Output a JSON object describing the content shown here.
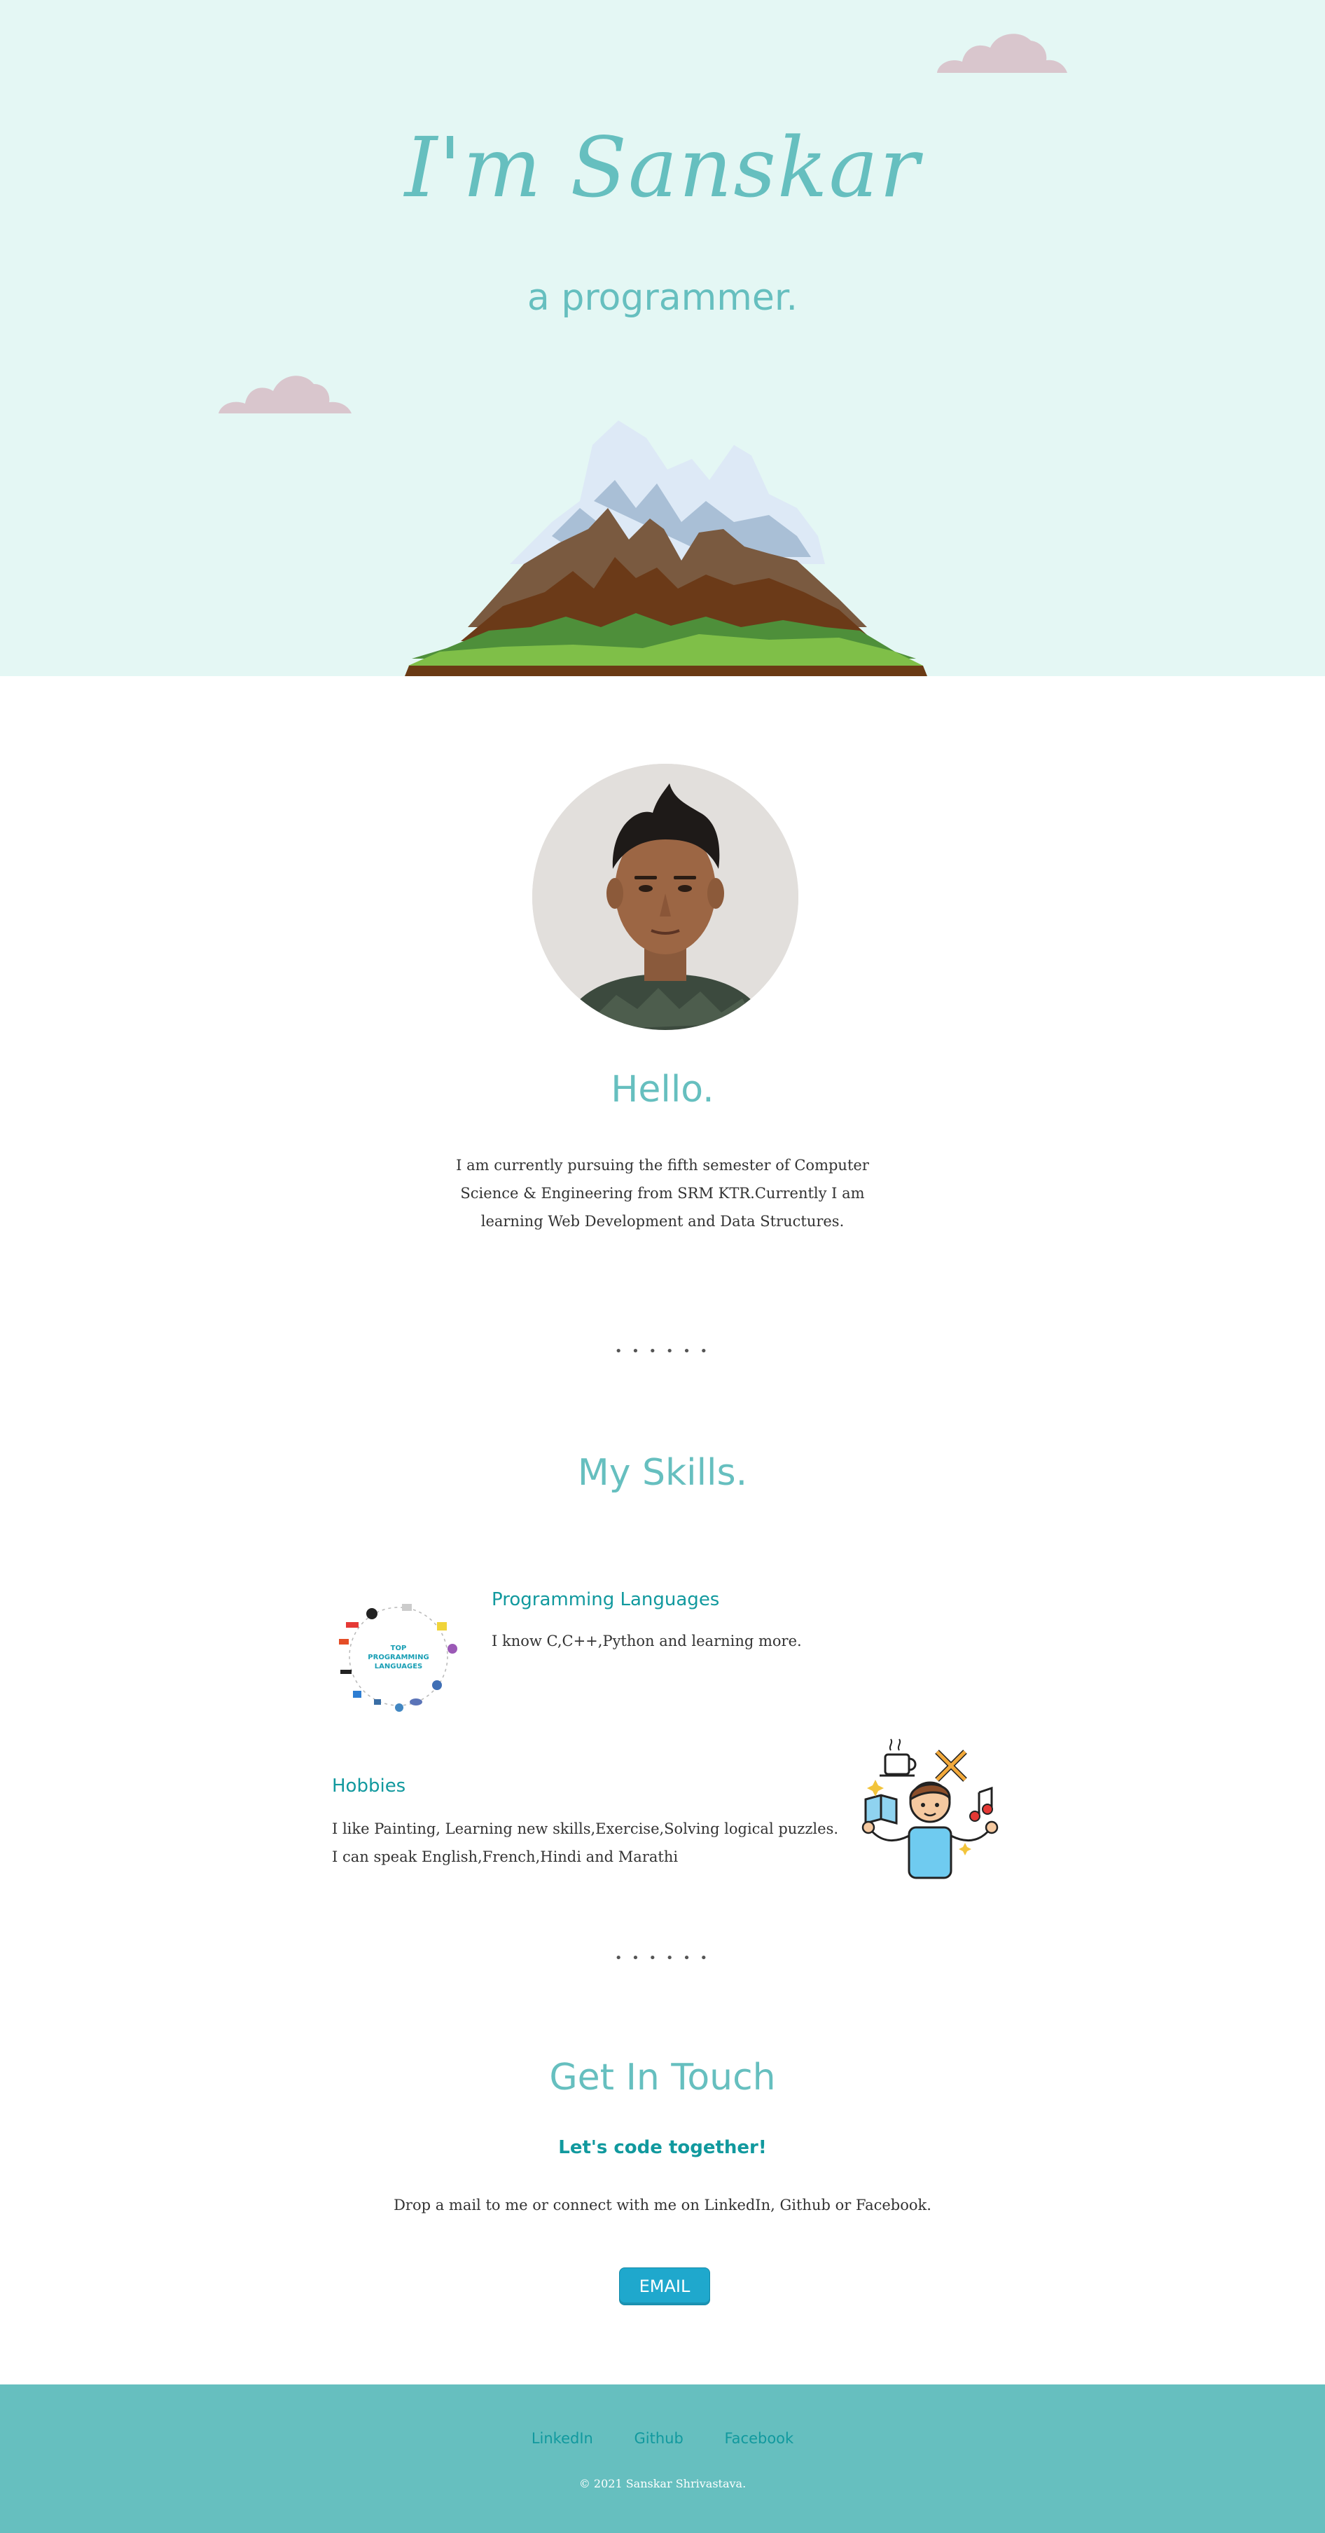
{
  "hero": {
    "title": "I'm Sanskar",
    "subtitle": "a programmer."
  },
  "about": {
    "heading": "Hello.",
    "intro": "I am currently pursuing the fifth semester of Computer Science & Engineering from SRM KTR.Currently I am learning Web Development and Data Structures."
  },
  "divider": "• • • • • •",
  "skills": {
    "heading": "My Skills.",
    "items": [
      {
        "title": "Programming Languages",
        "text": "I know C,C++,Python and learning more.",
        "image_label": "TOP PROGRAMMING LANGUAGES"
      },
      {
        "title": "Hobbies",
        "text": "I like Painting, Learning new skills,Exercise,Solving logical puzzles. I can speak English,French,Hindi and Marathi"
      }
    ]
  },
  "contact": {
    "heading": "Get In Touch",
    "subheading": "Let's code together!",
    "text": "Drop a mail to me or connect with me on LinkedIn, Github or Facebook.",
    "button": "EMAIL"
  },
  "footer": {
    "links": [
      "LinkedIn",
      "Github",
      "Facebook"
    ],
    "copyright": "© 2021 Sanskar Shrivastava."
  },
  "colors": {
    "hero_bg": "#e4f7f4",
    "accent": "#66BFBF",
    "accent_dark": "#11999E",
    "button": "#1fa8cd",
    "cloud": "#d9c6cd"
  }
}
